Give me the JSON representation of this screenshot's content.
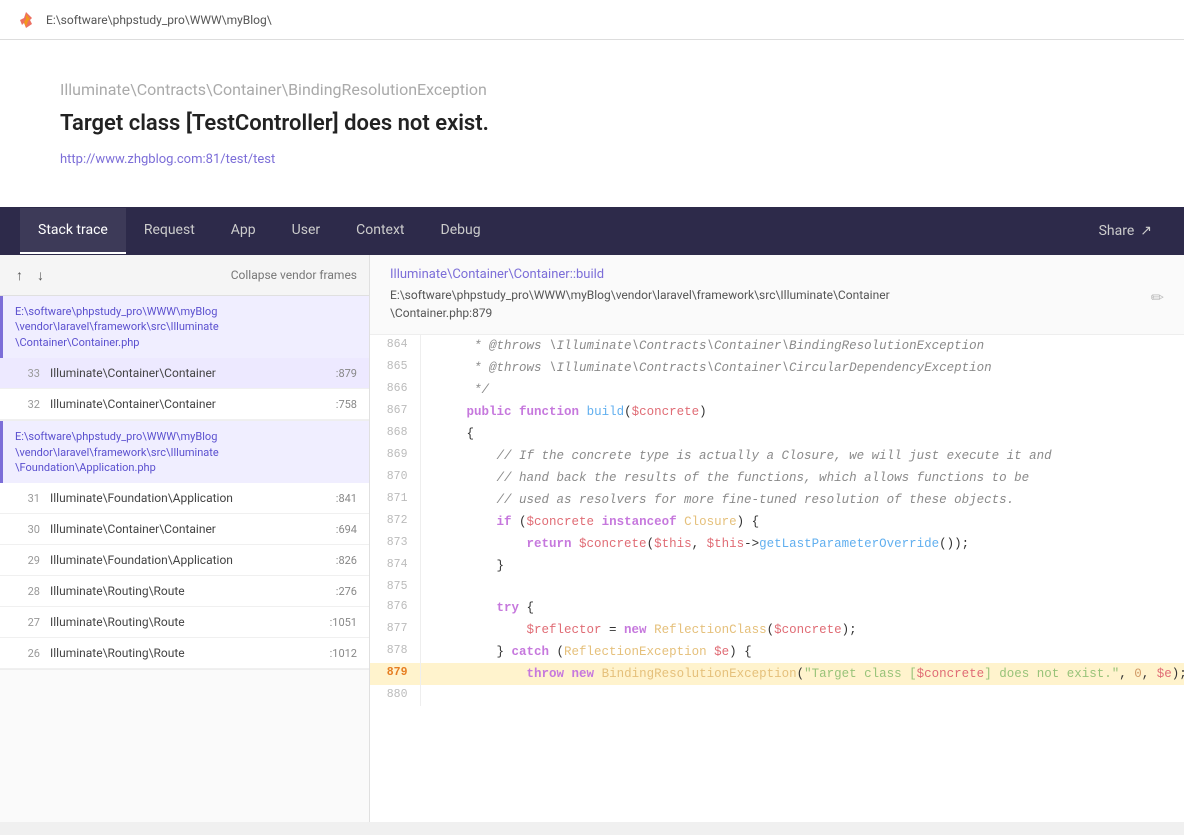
{
  "titleBar": {
    "path": "E:\\software\\phpstudy_pro\\WWW\\myBlog\\"
  },
  "errorSection": {
    "exceptionClass": "Illuminate\\Contracts\\Container\\BindingResolutionException",
    "message": "Target class [TestController] does not exist.",
    "url": "http://www.zhgblog.com:81/test/test"
  },
  "tabs": {
    "items": [
      "Stack trace",
      "Request",
      "App",
      "User",
      "Context",
      "Debug"
    ],
    "activeIndex": 0,
    "shareLabel": "Share"
  },
  "stackPanel": {
    "collapseLabel": "Collapse vendor frames",
    "frames": [
      {
        "type": "group",
        "file": "E:\\software\\phpstudy_pro\\WWW\\myBlog\\vendor\\laravel\\framework\\src\\Illuminate\\Container\\Container.php",
        "items": [
          {
            "number": "33",
            "class": "Illuminate\\Container\\Container",
            "line": ":879",
            "active": true
          },
          {
            "number": "32",
            "class": "Illuminate\\Container\\Container",
            "line": ":758"
          }
        ]
      },
      {
        "type": "group",
        "file": "E:\\software\\phpstudy_pro\\WWW\\myBlog\\vendor\\laravel\\framework\\src\\Illuminate\\Foundation\\Application.php",
        "items": [
          {
            "number": "31",
            "class": "Illuminate\\Foundation\\Application",
            "line": ":841"
          },
          {
            "number": "30",
            "class": "Illuminate\\Container\\Container",
            "line": ":694"
          },
          {
            "number": "29",
            "class": "Illuminate\\Foundation\\Application",
            "line": ":826"
          },
          {
            "number": "28",
            "class": "Illuminate\\Routing\\Route",
            "line": ":276"
          },
          {
            "number": "27",
            "class": "Illuminate\\Routing\\Route",
            "line": ":1051"
          },
          {
            "number": "26",
            "class": "Illuminate\\Routing\\Route",
            "line": ":1012"
          }
        ]
      }
    ]
  },
  "codePanel": {
    "fileClass": "Illuminate\\Container\\Container::build",
    "filePath": "E:\\software\\phpstudy_pro\\WWW\\myBlog\\vendor\\laravel\\framework\\src\\Illuminate\\Container\\Container.php:879",
    "highlightLine": 879,
    "lines": [
      {
        "num": 864,
        "code": "     * @throws \\Illuminate\\Contracts\\Container\\BindingResolutionException"
      },
      {
        "num": 865,
        "code": "     * @throws \\Illuminate\\Contracts\\Container\\CircularDependencyException"
      },
      {
        "num": 866,
        "code": "     */"
      },
      {
        "num": 867,
        "code": "    public function build($concrete)"
      },
      {
        "num": 868,
        "code": "    {"
      },
      {
        "num": 869,
        "code": "        // If the concrete type is actually a Closure, we will just execute it and"
      },
      {
        "num": 870,
        "code": "        // hand back the results of the functions, which allows functions to be"
      },
      {
        "num": 871,
        "code": "        // used as resolvers for more fine-tuned resolution of these objects."
      },
      {
        "num": 872,
        "code": "        if ($concrete instanceof Closure) {"
      },
      {
        "num": 873,
        "code": "            return $concrete($this, $this->getLastParameterOverride());"
      },
      {
        "num": 874,
        "code": "        }"
      },
      {
        "num": 875,
        "code": ""
      },
      {
        "num": 876,
        "code": "        try {"
      },
      {
        "num": 877,
        "code": "            $reflector = new ReflectionClass($concrete);"
      },
      {
        "num": 878,
        "code": "        } catch (ReflectionException $e) {"
      },
      {
        "num": 879,
        "code": "            throw new BindingResolutionException(\"Target class [$concrete] does not exist.\", 0, $e);"
      },
      {
        "num": 880,
        "code": ""
      }
    ]
  }
}
